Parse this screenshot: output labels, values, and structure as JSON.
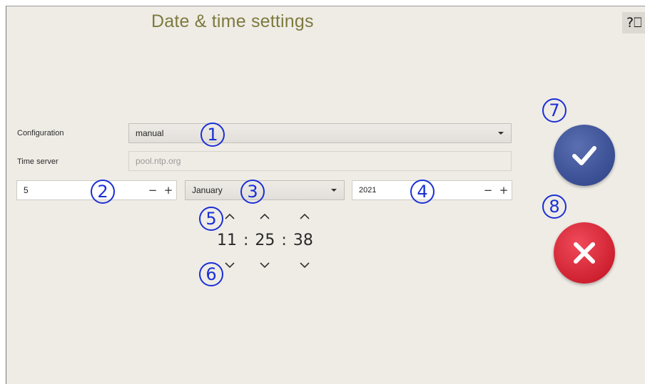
{
  "header": {
    "title": "Date & time settings",
    "help_label": "?⎕"
  },
  "configuration": {
    "label": "Configuration",
    "value": "manual"
  },
  "time_server": {
    "label": "Time server",
    "value": "pool.ntp.org"
  },
  "date": {
    "day": "5",
    "month": "January",
    "year": "2021",
    "minus": "−",
    "plus": "+"
  },
  "time": {
    "hours": "11",
    "minutes": "25",
    "seconds": "38",
    "separator": ":"
  },
  "markers": [
    "1",
    "2",
    "3",
    "4",
    "5",
    "6",
    "7",
    "8"
  ],
  "colors": {
    "title": "#7d7a3e",
    "ok": "#2b3f86",
    "cancel": "#c0101f",
    "marker": "#1a2fd6"
  }
}
